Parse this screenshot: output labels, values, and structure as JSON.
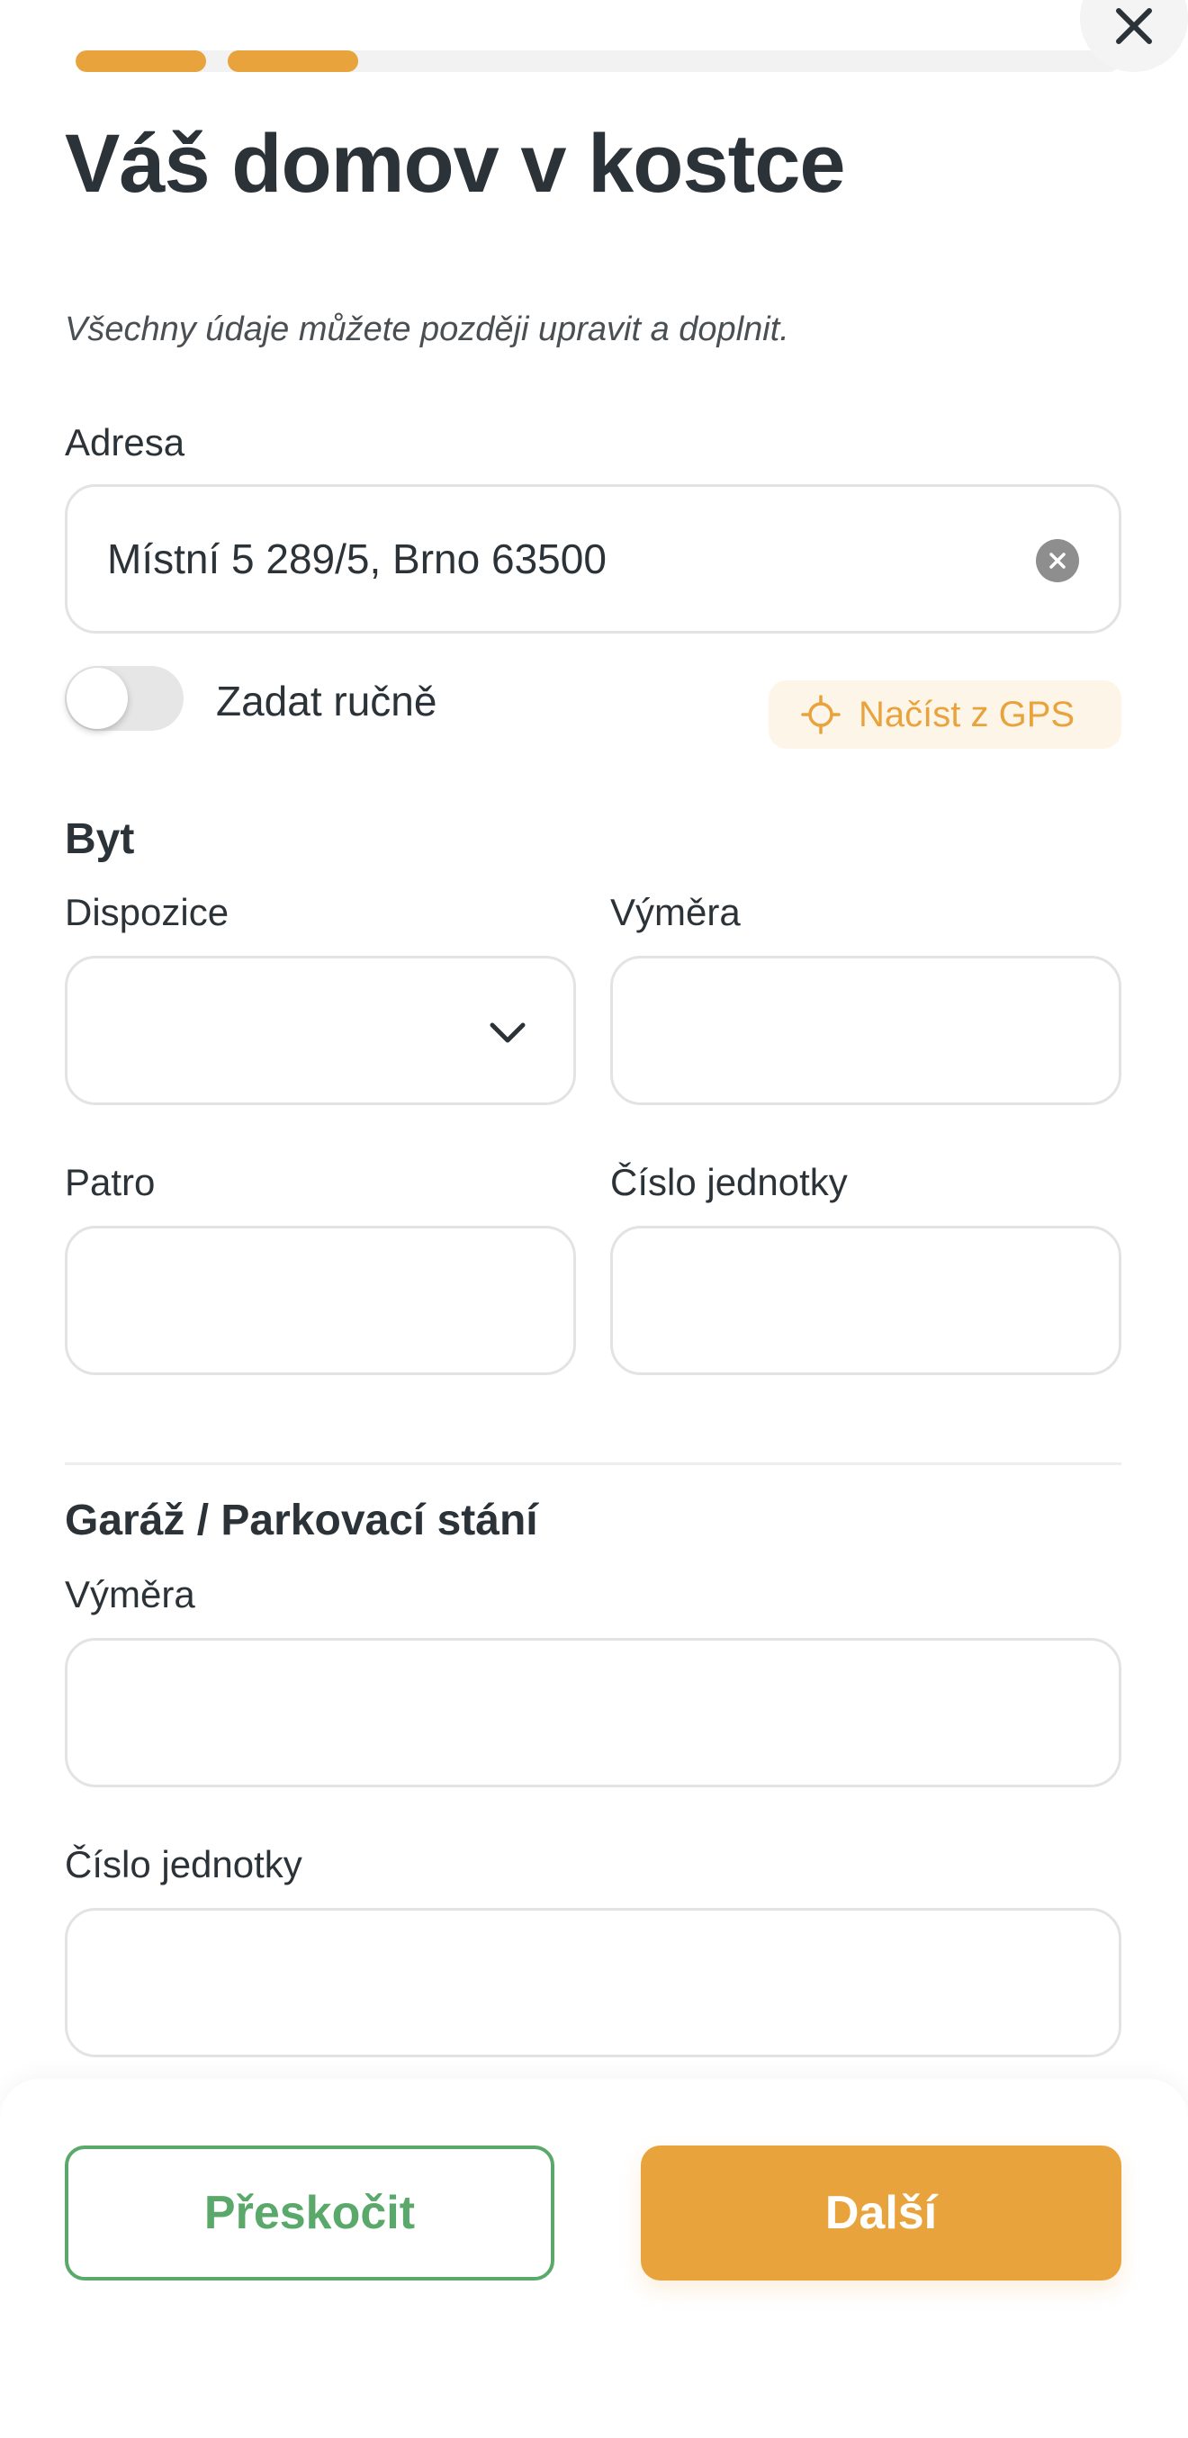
{
  "progress": {
    "total_steps": 7,
    "completed_steps": 2,
    "color": "#e8a33c"
  },
  "header": {
    "title": "Váš domov v kostce",
    "subtitle": "Všechny údaje můžete později upravit a doplnit.",
    "close_icon": "close-icon"
  },
  "address": {
    "label": "Adresa",
    "value": "Místní 5 289/5, Brno 63500",
    "clear_icon": "clear-circle-icon"
  },
  "manual_toggle": {
    "label": "Zadat ručně",
    "on": false
  },
  "gps_button": {
    "label": "Načíst z GPS",
    "icon": "crosshair-icon",
    "color": "#e8a33c",
    "background": "#fdf5e8"
  },
  "apartment": {
    "title": "Byt",
    "layout": {
      "label": "Dispozice",
      "value": "",
      "icon": "chevron-down-icon"
    },
    "area": {
      "label": "Výměra",
      "value": ""
    },
    "floor": {
      "label": "Patro",
      "value": ""
    },
    "unit_number": {
      "label": "Číslo jednotky",
      "value": ""
    }
  },
  "garage": {
    "title": "Garáž / Parkovací stání",
    "area": {
      "label": "Výměra",
      "value": ""
    },
    "unit_number": {
      "label": "Číslo jednotky",
      "value": ""
    }
  },
  "footer": {
    "skip_label": "Přeskočit",
    "next_label": "Další",
    "skip_color": "#5aa86a",
    "next_color": "#e8a33c"
  }
}
